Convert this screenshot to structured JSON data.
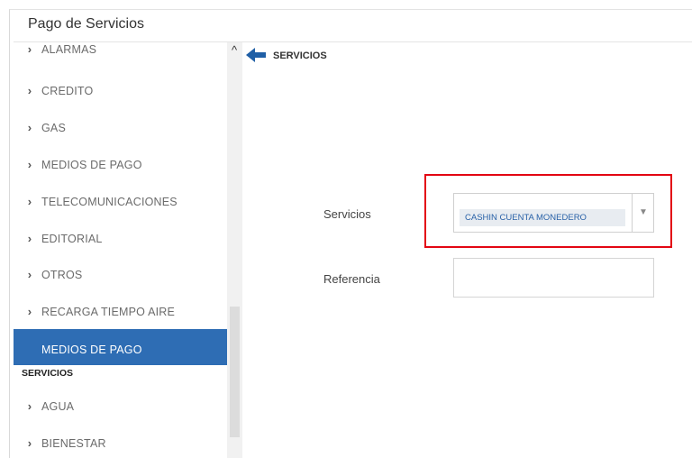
{
  "app": {
    "title": "Pago de Servicios"
  },
  "sidebar": {
    "items": [
      {
        "label": "ALARMAS"
      },
      {
        "label": "CREDITO"
      },
      {
        "label": "GAS"
      },
      {
        "label": "MEDIOS DE PAGO"
      },
      {
        "label": "TELECOMUNICACIONES"
      },
      {
        "label": "EDITORIAL"
      },
      {
        "label": "OTROS"
      },
      {
        "label": "RECARGA TIEMPO AIRE"
      }
    ],
    "active_item": {
      "label": "MEDIOS DE PAGO"
    },
    "section_header": "SERVICIOS",
    "section_items": [
      {
        "label": "AGUA"
      },
      {
        "label": "BIENESTAR"
      }
    ]
  },
  "main": {
    "breadcrumb": "SERVICIOS",
    "servicios": {
      "label": "Servicios",
      "selected_value": "CASHIN CUENTA MONEDERO"
    },
    "referencia": {
      "label": "Referencia",
      "value": ""
    }
  },
  "colors": {
    "active_item_bg": "#2e6db4",
    "back_arrow": "#1f5fa6",
    "highlight_border": "#e30613"
  },
  "icons": {
    "chevron": "chevron-right-icon",
    "back": "arrow-left-icon",
    "scroll_up": "chevron-up-icon",
    "dropdown": "caret-down-icon"
  }
}
